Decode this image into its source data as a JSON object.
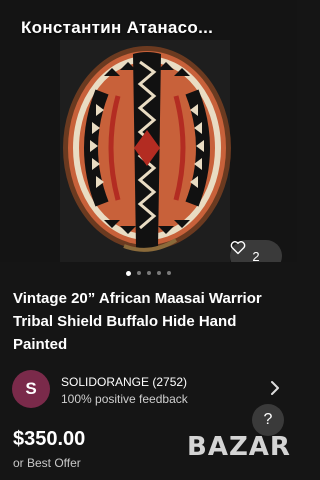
{
  "header": {
    "seller_overlay_name": "Константин Атанасо..."
  },
  "gallery": {
    "favorite_count": "2",
    "image_count": 5,
    "active_index": 0
  },
  "listing": {
    "title": "Vintage 20” African Maasai Warrior Tribal Shield Buffalo Hide Hand Painted",
    "price": "$350.00",
    "offer_text": "or Best Offer"
  },
  "seller": {
    "avatar_letter": "S",
    "name_rating": "SOLIDORANGE (2752)",
    "feedback": "100% positive feedback"
  },
  "help": {
    "label": "?"
  },
  "watermark": {
    "text": "BAZAR"
  },
  "colors": {
    "background": "#151515",
    "avatar": "#7a2a4a",
    "shield_orange": "#c8613a",
    "shield_black": "#111111",
    "shield_cream": "#e9dcc3",
    "shield_red": "#b32c22"
  }
}
